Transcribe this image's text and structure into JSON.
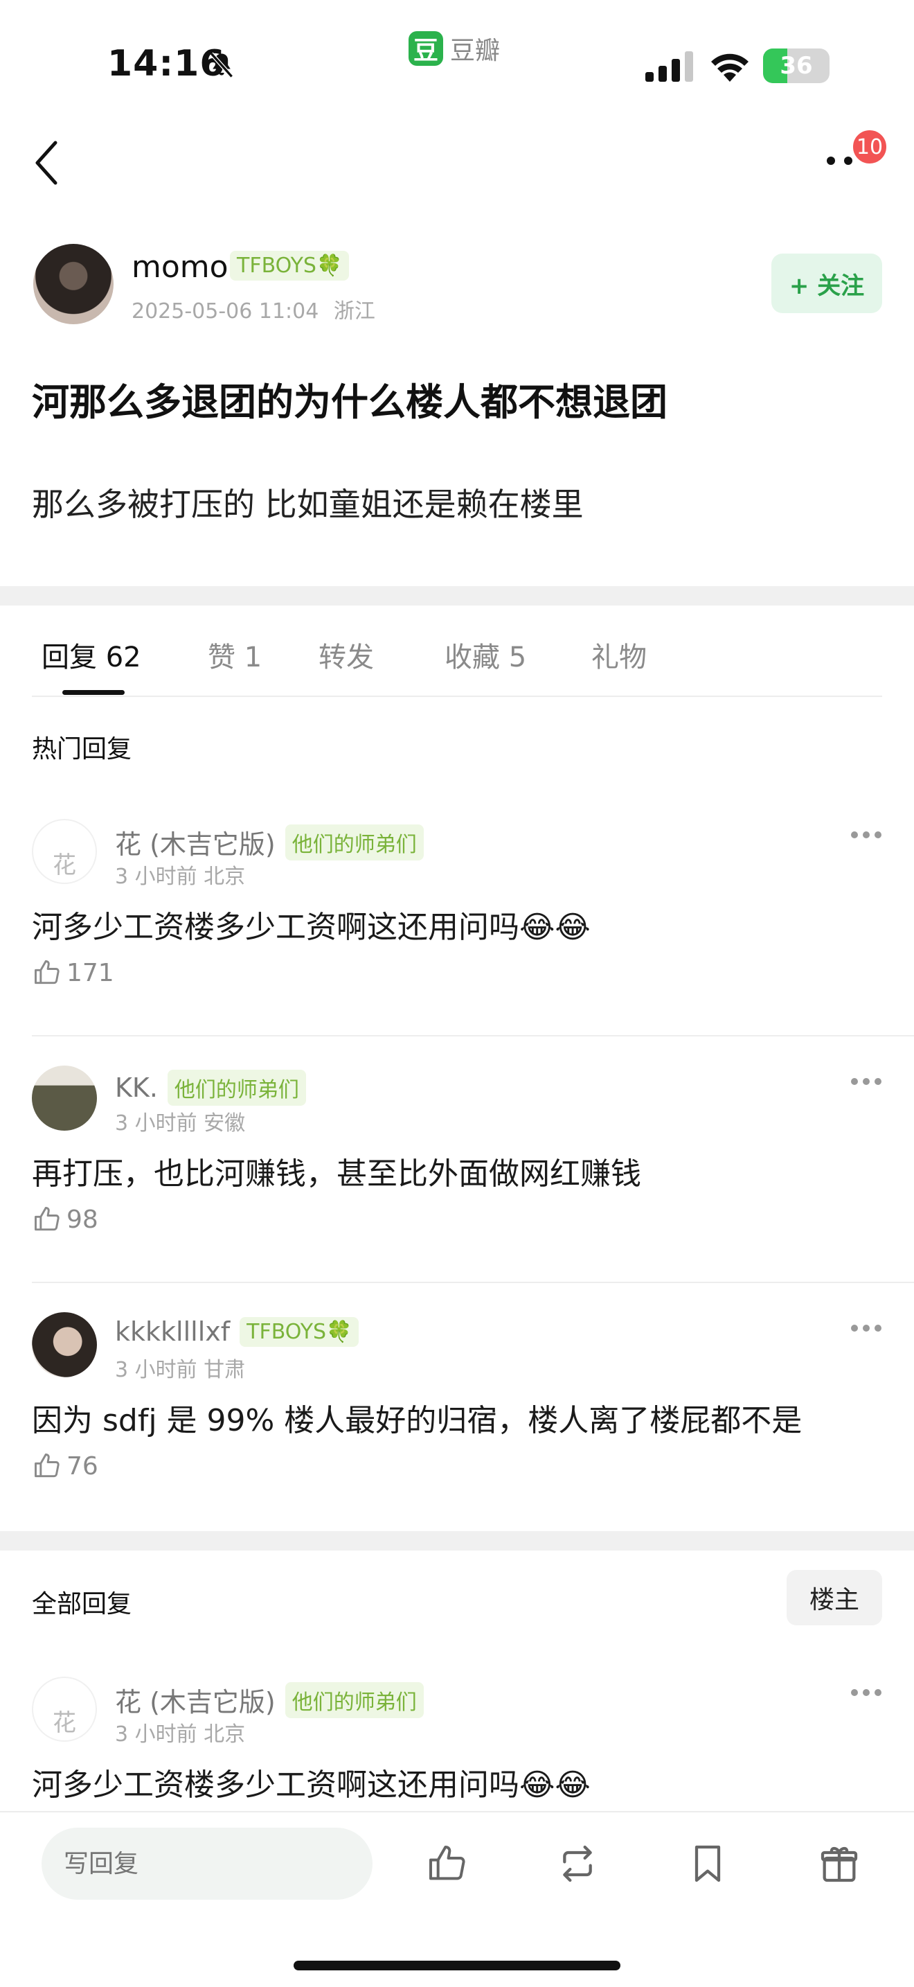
{
  "status_bar": {
    "time": "14:16",
    "app_logo": "豆",
    "app_name": "豆瓣",
    "battery": "36",
    "battery_level": 0.36
  },
  "nav": {
    "notification_count": "10"
  },
  "post": {
    "author": "momo",
    "author_badge": "TFBOYS🍀",
    "datetime": "2025-05-06 11:04",
    "location": "浙江",
    "follow_label": "+ 关注",
    "title": "河那么多退团的为什么楼人都不想退团",
    "body": "那么多被打压的 比如童姐还是赖在楼里"
  },
  "tabs": [
    {
      "label": "回复 62"
    },
    {
      "label": "赞 1"
    },
    {
      "label": "转发"
    },
    {
      "label": "收藏 5"
    },
    {
      "label": "礼物"
    }
  ],
  "hot_section_title": "热门回复",
  "hot_comments": [
    {
      "name": "花 (木吉它版)",
      "badge": "他们的师弟们",
      "meta": "3 小时前 北京",
      "avatar_text": "花",
      "text": "河多少工资楼多少工资啊这还用问吗😂😂",
      "likes": "171"
    },
    {
      "name": "KK.",
      "badge": "他们的师弟们",
      "meta": "3 小时前 安徽",
      "text": "再打压，也比河赚钱，甚至比外面做网红赚钱",
      "likes": "98"
    },
    {
      "name": "kkkkllllxf",
      "badge": "TFBOYS🍀",
      "meta": "3 小时前 甘肃",
      "text": "因为 sdfj 是 99% 楼人最好的归宿，楼人离了楼屁都不是",
      "likes": "76"
    }
  ],
  "all_section_title": "全部回复",
  "owner_filter_label": "楼主",
  "all_comments": [
    {
      "name": "花 (木吉它版)",
      "badge": "他们的师弟们",
      "meta": "3 小时前 北京",
      "avatar_text": "花",
      "text": "河多少工资楼多少工资啊这还用问吗😂😂"
    }
  ],
  "bottom_bar": {
    "reply_placeholder": "写回复"
  },
  "colors": {
    "brand_green": "#2bb24c",
    "badge_green": "#7ab33a",
    "follow_green": "#2aa14a",
    "notification_red": "#f25454"
  },
  "icons": [
    "bell-slash-icon",
    "signal-icon",
    "wifi-icon",
    "battery-icon",
    "back-icon",
    "more-icon",
    "like-icon",
    "repost-icon",
    "bookmark-icon",
    "gift-icon"
  ]
}
